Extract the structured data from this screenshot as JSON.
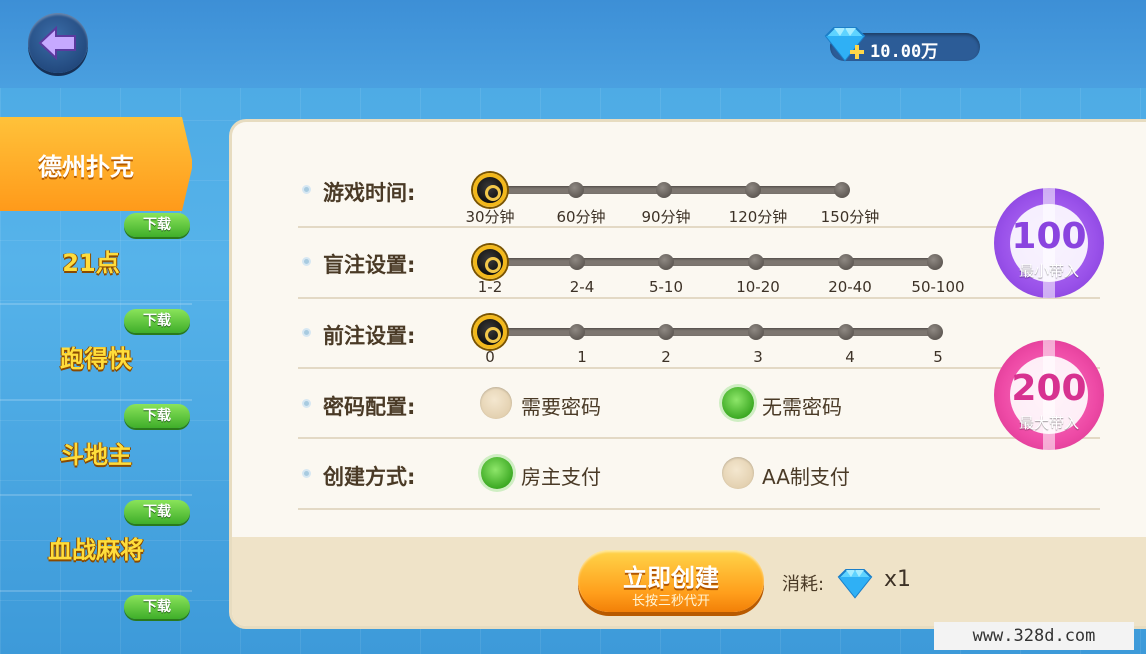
{
  "header": {
    "balance": "10.00万"
  },
  "sidebar": {
    "tabs": [
      {
        "label": "德州扑克",
        "active": true,
        "download": ""
      },
      {
        "label": "21点",
        "active": false,
        "download": "下载"
      },
      {
        "label": "跑得快",
        "active": false,
        "download": "下载"
      },
      {
        "label": "斗地主",
        "active": false,
        "download": "下载"
      },
      {
        "label": "血战麻将",
        "active": false,
        "download": "下载"
      },
      {
        "label": "",
        "active": false,
        "download": "下载"
      }
    ]
  },
  "settings": {
    "game_time": {
      "label": "游戏时间:",
      "options": [
        "30分钟",
        "60分钟",
        "90分钟",
        "120分钟",
        "150分钟"
      ],
      "selected_index": 0
    },
    "blinds": {
      "label": "盲注设置:",
      "options": [
        "1-2",
        "2-4",
        "5-10",
        "10-20",
        "20-40",
        "50-100"
      ],
      "selected_index": 0
    },
    "ante": {
      "label": "前注设置:",
      "options": [
        "0",
        "1",
        "2",
        "3",
        "4",
        "5"
      ],
      "selected_index": 0
    },
    "password": {
      "label": "密码配置:",
      "options": [
        "需要密码",
        "无需密码"
      ],
      "selected_index": 1
    },
    "create_method": {
      "label": "创建方式:",
      "options": [
        "房主支付",
        "AA制支付"
      ],
      "selected_index": 0
    }
  },
  "chips": {
    "min": {
      "value": "100",
      "label": "最小带入"
    },
    "max": {
      "value": "200",
      "label": "最大带入"
    }
  },
  "footer": {
    "create_label": "立即创建",
    "create_sub": "长按三秒代开",
    "cost_label": "消耗:",
    "cost_value": "x1"
  },
  "watermark": "www.328d.com",
  "colors": {
    "accent_orange": "#ff9e1b",
    "selected_green": "#3daa24",
    "chip_purple": "#9a52ea",
    "chip_pink": "#ee4aa6"
  }
}
